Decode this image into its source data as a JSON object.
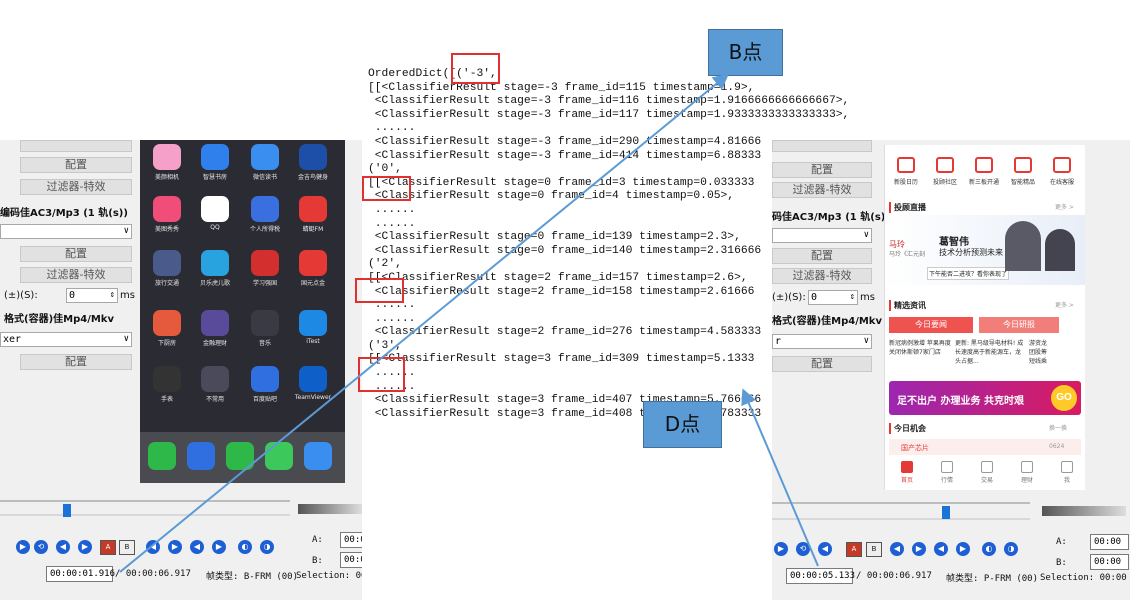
{
  "left_panel": {
    "config_label": "配置",
    "filter_label": "过滤器-特效",
    "audio_codec_label": "编码佳AC3/Mp3 (1 轨(s))",
    "offset_label": "(±)(S):",
    "offset_value": "0",
    "offset_unit": "ms",
    "format_label": "格式(容器)佳Mp4/Mkv",
    "muxer_value": "xer",
    "current_time": "00:00:01.916",
    "total_time": "/ 00:00:06.917",
    "frame_type": "帧类型: B-FRM (00)",
    "a_label": "A:",
    "b_label": "B:",
    "a_value": "00:0",
    "b_value": "00:0",
    "selection_label": "Selection: 00:("
  },
  "phone_apps": [
    {
      "name": "美颜相机",
      "color": "#f5a0c8"
    },
    {
      "name": "智慧书房",
      "color": "#2f80ed"
    },
    {
      "name": "微信读书",
      "color": "#3a8ef0"
    },
    {
      "name": "金吉鸟健身",
      "color": "#1d4ea8"
    },
    {
      "name": "美图秀秀",
      "color": "#f04d78"
    },
    {
      "name": "QQ",
      "color": "#ffffff"
    },
    {
      "name": "个人所得税",
      "color": "#3a6fe0"
    },
    {
      "name": "蜻蜓FM",
      "color": "#e53935"
    },
    {
      "name": "旅行交通",
      "color": "#4a5a8a"
    },
    {
      "name": "贝乐虎儿歌",
      "color": "#29a3e0"
    },
    {
      "name": "学习强国",
      "color": "#d32f2f"
    },
    {
      "name": "国元点金",
      "color": "#e53935"
    },
    {
      "name": "下厨房",
      "color": "#e55a3c"
    },
    {
      "name": "金融理财",
      "color": "#5a4a9a"
    },
    {
      "name": "音乐",
      "color": "#3a3a44"
    },
    {
      "name": "iTest",
      "color": "#1e88e5"
    },
    {
      "name": "手表",
      "color": "#333333"
    },
    {
      "name": "不常用",
      "color": "#4a4a5a"
    },
    {
      "name": "百度贴吧",
      "color": "#2f6fe0"
    },
    {
      "name": "TeamViewer",
      "color": "#0e5fc8"
    }
  ],
  "dock_apps": [
    {
      "name": "phone",
      "color": "#2fb84a"
    },
    {
      "name": "fiveeight",
      "color": "#2f6fe0"
    },
    {
      "name": "wechat",
      "color": "#2fb84a"
    },
    {
      "name": "messages",
      "color": "#3cc85a"
    },
    {
      "name": "plane",
      "color": "#3a8ef0"
    }
  ],
  "code_lines": [
    "OrderedDict([('-3',",
    "[[<ClassifierResult stage=-3 frame_id=115 timestamp=1.9>,",
    " <ClassifierResult stage=-3 frame_id=116 timestamp=1.9166666666666667>,",
    " <ClassifierResult stage=-3 frame_id=117 timestamp=1.9333333333333333>,",
    " ......",
    " <ClassifierResult stage=-3 frame_id=290 timestamp=4.81666",
    " <ClassifierResult stage=-3 frame_id=414 timestamp=6.88333",
    "('0',",
    "[[<ClassifierResult stage=0 frame_id=3 timestamp=0.033333",
    " <ClassifierResult stage=0 frame_id=4 timestamp=0.05>,",
    " ......",
    " ......",
    " <ClassifierResult stage=0 frame_id=139 timestamp=2.3>,",
    " <ClassifierResult stage=0 frame_id=140 timestamp=2.316666",
    "('2',",
    "[[<ClassifierResult stage=2 frame_id=157 timestamp=2.6>,",
    " <ClassifierResult stage=2 frame_id=158 timestamp=2.61666",
    " ......",
    " ......",
    " <ClassifierResult stage=2 frame_id=276 timestamp=4.583333",
    "('3',",
    "[[<ClassifierResult stage=3 frame_id=309 timestamp=5.1333",
    " ......",
    " ......",
    " <ClassifierResult stage=3 frame_id=407 timestamp=5.766666",
    " <ClassifierResult stage=3 frame_id=408 timestamp=5.783333"
  ],
  "callouts": {
    "b_point": "B点",
    "d_point": "D点"
  },
  "right_panel": {
    "config_label": "配置",
    "filter_label": "过滤器-特效",
    "audio_codec_label": "码佳AC3/Mp3 (1 轨(s))",
    "offset_label": "(±)(S):",
    "offset_value": "0",
    "offset_unit": "ms",
    "format_label": "格式(容器)佳Mp4/Mkv",
    "muxer_value": "r",
    "current_time": "00:00:05.133",
    "total_time": "/ 00:00:06.917",
    "frame_type": "帧类型: P-FRM (00)",
    "a_label": "A:",
    "b_label": "B:",
    "a_value": "00:00",
    "b_value": "00:00",
    "selection_label": "Selection: 00:00"
  },
  "right_app": {
    "top_icons": [
      "新股日历",
      "投顾社区",
      "新三板开通",
      "智能精品",
      "在线客服"
    ],
    "live_title": "投顾直播",
    "more": "更多 >",
    "host_name": "葛智伟",
    "host_topic": "技术分析预测未来",
    "mini_name": "马玲",
    "mini_sub": "马玲《汇元刻",
    "next_text": "下午能否二进攻？看你表现了",
    "news_title": "精选资讯",
    "tab_today_news": "今日要闻",
    "tab_today_report": "今日研报",
    "news1": "新冠病例激增 苹果再度关闭休斯顿7家门店",
    "news2": "更新: 黑马级导电材料! 成长速度高于新能源车，龙头占据...",
    "news3": "游资龙团股筹短线乘",
    "banner_text": "足不出户 办理业务 共克时艰",
    "banner_go": "GO",
    "opportunity_title": "今日机会",
    "refresh": "换一换",
    "chip_tag": "国产芯片",
    "chip_date": "0624",
    "nav": [
      "首页",
      "行情",
      "交易",
      "理财",
      "我"
    ]
  }
}
